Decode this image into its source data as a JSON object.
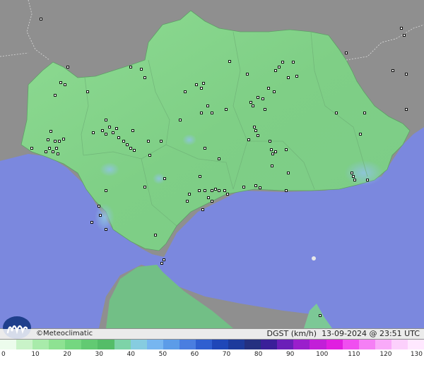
{
  "copyright": "©Meteoclimatic",
  "product": "DGST (km/h)",
  "timestamp": "13-09-2024 @ 23:51 UTC",
  "legend": {
    "ticks": [
      "0",
      "10",
      "20",
      "30",
      "40",
      "50",
      "60",
      "70",
      "80",
      "90",
      "100",
      "110",
      "120",
      "130"
    ],
    "colors": [
      "#ecfcec",
      "#c9f3c8",
      "#a8ebaa",
      "#8ee292",
      "#74d780",
      "#62ca72",
      "#54bd68",
      "#7dd3a8",
      "#86cce0",
      "#77b6f0",
      "#5c9ce8",
      "#4a7ee0",
      "#2f5fd0",
      "#1f47b8",
      "#1d3a9c",
      "#243080",
      "#3a1f99",
      "#6a1fb8",
      "#9a1fcc",
      "#c21fd8",
      "#e01fe0",
      "#f04ef0",
      "#f57ff5",
      "#f9aaf9",
      "#fcd0fc",
      "#ffe8ff"
    ]
  },
  "colors": {
    "sea": "#7b88de",
    "land_outside": "#8f8f8f",
    "andalusia_light": "#8fd891",
    "andalusia_dark": "#72c37c"
  },
  "icons": [
    "meteoclimatic-logo",
    "station-marker"
  ]
}
